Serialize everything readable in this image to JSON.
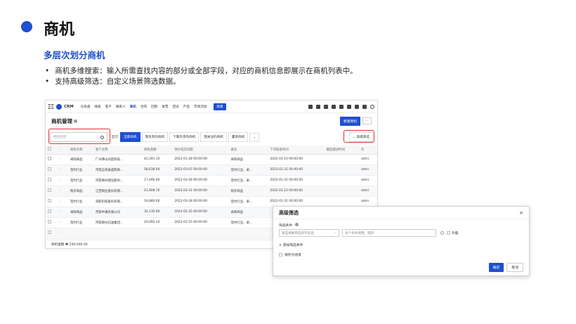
{
  "slide": {
    "title": "商机",
    "subtitle": "多层次划分商机",
    "bullets": [
      "商机多维搜索：输入所需查找内容的部分或全部字段，对应的商机信息即展示在商机列表中。",
      "支持高级筛选：自定义场景筛选数据。"
    ]
  },
  "crm": {
    "brand": "CRM",
    "nav": [
      "仪表盘",
      "线索",
      "客户",
      "联系人",
      "商机",
      "合同",
      "回款",
      "发票",
      "回访",
      "产品",
      "市场活动"
    ],
    "nav_new": "新建",
    "page_title": "商机管理",
    "new_button": "新建商机",
    "more_button": "···",
    "search_placeholder": "商机名称",
    "filter_label": "显示",
    "segments": [
      "全部商机",
      "我负责的商机",
      "下属负责的商机",
      "我关注的商机",
      "赢单商机"
    ],
    "segment_more": "⌄",
    "adv_filter_button": "高级筛选",
    "columns": [
      "",
      "",
      "商机名称",
      "客户名称",
      "商机金额",
      "预计成交日期",
      "备注",
      "下次联系时间",
      "最后跟进时间",
      "负"
    ],
    "rows": [
      {
        "name": "采购商品",
        "customer": "广州佛山同盈科技...",
        "amount": "42,391.10",
        "date": "2022-01-28 00:00:00",
        "note": "采购商品",
        "next": "2022-01-10 00:00:00",
        "last": "",
        "owner": "admi"
      },
      {
        "name": "签约行业",
        "customer": "河南正商泰盛和商...",
        "amount": "58,638.00",
        "date": "2022-03-07 00:00:00",
        "note": "签约行业、采...",
        "next": "2022-01-31 00:00:00",
        "last": "",
        "owner": "admi"
      },
      {
        "name": "签约行业",
        "customer": "河南郑州建设股份...",
        "amount": "17,490.00",
        "date": "2022-03-28 00:00:00",
        "note": "签约行业、采...",
        "next": "2022-01-31 00:00:00",
        "last": "",
        "owner": "admi"
      },
      {
        "name": "购买商品",
        "customer": "江西铜业股份有限...",
        "amount": "21,908.70",
        "date": "2022-03-31 00:00:00",
        "note": "购买商品",
        "next": "2022-01-10 00:00:00",
        "last": "",
        "owner": "admi"
      },
      {
        "name": "签约行业",
        "customer": "海航科技股份有限...",
        "amount": "16,880.00",
        "date": "2022-03-28 00:00:00",
        "note": "签约行业、采...",
        "next": "2022-01-31 00:00:00",
        "last": "",
        "owner": "admi"
      },
      {
        "name": "采购商品",
        "customer": "河南中通有限公司",
        "amount": "32,130.00",
        "date": "2022-02-25 00:00:00",
        "note": "采购商品",
        "next": "",
        "last": "",
        "owner": ""
      },
      {
        "name": "签约行业",
        "customer": "河南郑州石油集团...",
        "amount": "29,092.10",
        "date": "2022-02-25 00:00:00",
        "note": "签约行业、采...",
        "next": "",
        "last": "",
        "owner": ""
      },
      {
        "name": "",
        "customer": "",
        "amount": "",
        "date": "",
        "note": "",
        "next": "",
        "last": "",
        "owner": ""
      }
    ],
    "footer": "商机金额 ❶ 249,000.00"
  },
  "dialog": {
    "title": "高级筛选",
    "close": "×",
    "condition_label": "筛选条件",
    "field_placeholder": "请选择要筛选的字段名",
    "value_placeholder": "多个条件请用；隔开",
    "external": "外露",
    "add_condition": "+ 添加筛选条件",
    "save_scene": "保存为场景",
    "ok": "确定",
    "cancel": "取消"
  },
  "colors": {
    "accent": "#1f4fd1",
    "highlight": "#e0302f",
    "amount": "#f08a00"
  }
}
